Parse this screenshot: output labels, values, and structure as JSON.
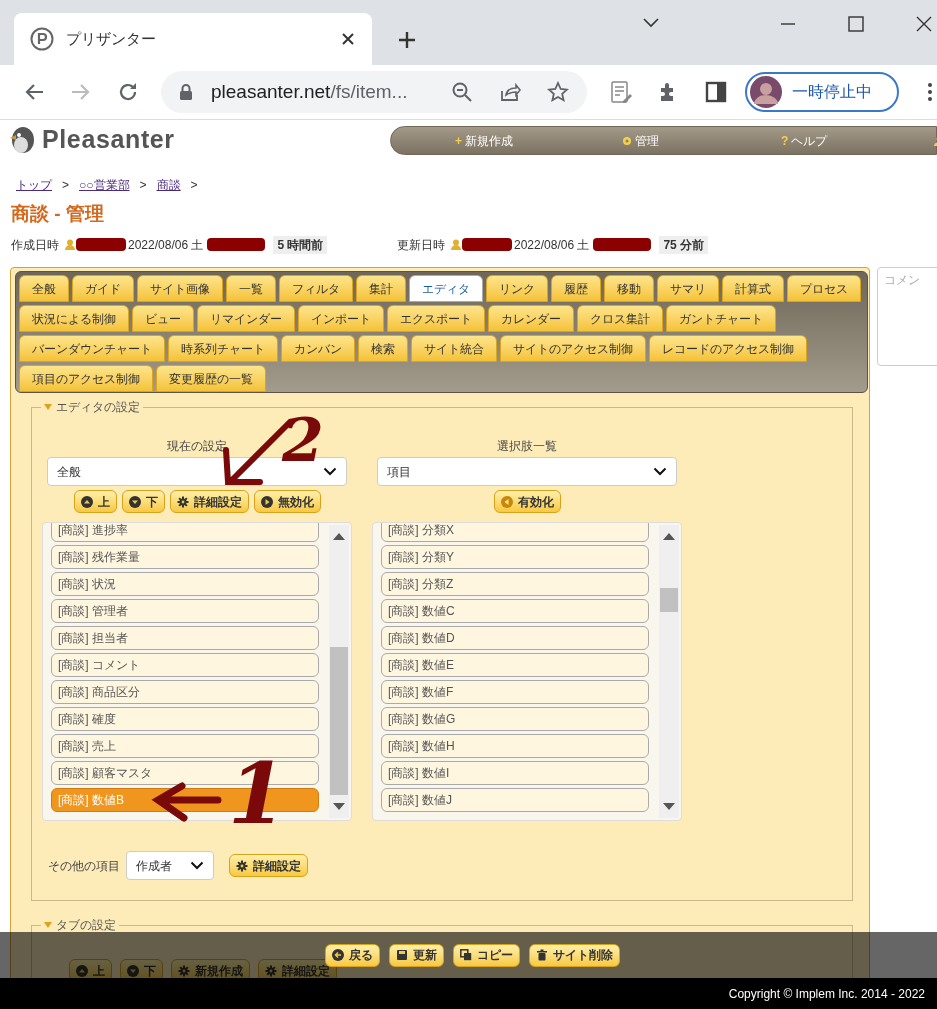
{
  "browser": {
    "tab_title": "プリザンター",
    "url_host": "pleasanter.net",
    "url_path": "/fs/item...",
    "profile_label": "一時停止中"
  },
  "header": {
    "logo_text": "Pleasanter",
    "nav": [
      {
        "kind": "char",
        "icon": "+",
        "label": "新規作成"
      },
      {
        "kind": "gear",
        "label": "管理"
      },
      {
        "kind": "char",
        "icon": "?",
        "label": "ヘルプ"
      },
      {
        "kind": "person"
      }
    ]
  },
  "breadcrumb": [
    {
      "label": "トップ",
      "separator": ">"
    },
    {
      "label": "○○営業部",
      "separator": ">"
    },
    {
      "label": "商談",
      "separator": ">"
    }
  ],
  "title": "商談 - 管理",
  "info": [
    {
      "label": "作成日時",
      "date": "2022/08/06 土",
      "relative": "5 時間前"
    },
    {
      "label": "更新日時",
      "date": "2022/08/06 土",
      "relative": "75 分前"
    }
  ],
  "tab_rows": [
    [
      {
        "label": "全般",
        "selected": false
      },
      {
        "label": "ガイド",
        "selected": false
      },
      {
        "label": "サイト画像",
        "selected": false
      },
      {
        "label": "一覧",
        "selected": false
      },
      {
        "label": "フィルタ",
        "selected": false
      },
      {
        "label": "集計",
        "selected": false
      },
      {
        "label": "エディタ",
        "selected": true
      },
      {
        "label": "リンク",
        "selected": false
      },
      {
        "label": "履歴",
        "selected": false
      },
      {
        "label": "移動",
        "selected": false
      },
      {
        "label": "サマリ",
        "selected": false
      },
      {
        "label": "計算式",
        "selected": false
      },
      {
        "label": "プロセス",
        "selected": false
      }
    ],
    [
      {
        "label": "状況による制御",
        "selected": false
      },
      {
        "label": "ビュー",
        "selected": false
      },
      {
        "label": "リマインダー",
        "selected": false
      },
      {
        "label": "インポート",
        "selected": false
      },
      {
        "label": "エクスポート",
        "selected": false
      },
      {
        "label": "カレンダー",
        "selected": false
      },
      {
        "label": "クロス集計",
        "selected": false
      },
      {
        "label": "ガントチャート",
        "selected": false
      }
    ],
    [
      {
        "label": "バーンダウンチャート",
        "selected": false
      },
      {
        "label": "時系列チャート",
        "selected": false
      },
      {
        "label": "カンバン",
        "selected": false
      },
      {
        "label": "検索",
        "selected": false
      },
      {
        "label": "サイト統合",
        "selected": false
      },
      {
        "label": "サイトのアクセス制御",
        "selected": false
      },
      {
        "label": "レコードのアクセス制御",
        "selected": false
      }
    ],
    [
      {
        "label": "項目のアクセス制御",
        "selected": false
      },
      {
        "label": "変更履歴の一覧",
        "selected": false
      }
    ]
  ],
  "comment": {
    "placeholder": "コメン"
  },
  "editor": {
    "legend": "エディタの設定",
    "current": {
      "heading": "現在の設定",
      "select": "全般",
      "buttons": [
        {
          "kind": "up",
          "label": "上"
        },
        {
          "kind": "down",
          "label": "下"
        },
        {
          "kind": "gear",
          "label": "詳細設定"
        },
        {
          "kind": "right",
          "label": "無効化"
        }
      ],
      "items": [
        {
          "label": "[商談] 進捗率",
          "selected": false
        },
        {
          "label": "[商談] 残作業量",
          "selected": false
        },
        {
          "label": "[商談] 状況",
          "selected": false
        },
        {
          "label": "[商談] 管理者",
          "selected": false
        },
        {
          "label": "[商談] 担当者",
          "selected": false
        },
        {
          "label": "[商談] コメント",
          "selected": false
        },
        {
          "label": "[商談] 商品区分",
          "selected": false
        },
        {
          "label": "[商談] 確度",
          "selected": false
        },
        {
          "label": "[商談] 売上",
          "selected": false
        },
        {
          "label": "[商談] 顧客マスタ",
          "selected": false
        },
        {
          "label": "[商談] 数値B",
          "selected": true
        }
      ]
    },
    "options": {
      "heading": "選択肢一覧",
      "select": "項目",
      "buttons": [
        {
          "kind": "left",
          "label": "有効化"
        }
      ],
      "items": [
        {
          "label": "[商談] 分類X",
          "selected": false
        },
        {
          "label": "[商談] 分類Y",
          "selected": false
        },
        {
          "label": "[商談] 分類Z",
          "selected": false
        },
        {
          "label": "[商談] 数値C",
          "selected": false
        },
        {
          "label": "[商談] 数値D",
          "selected": false
        },
        {
          "label": "[商談] 数値E",
          "selected": false
        },
        {
          "label": "[商談] 数値F",
          "selected": false
        },
        {
          "label": "[商談] 数値G",
          "selected": false
        },
        {
          "label": "[商談] 数値H",
          "selected": false
        },
        {
          "label": "[商談] 数値I",
          "selected": false
        },
        {
          "label": "[商談] 数値J",
          "selected": false
        }
      ]
    },
    "other": {
      "label": "その他の項目",
      "select": "作成者",
      "button": {
        "kind": "gear",
        "label": "詳細設定"
      }
    }
  },
  "tab_settings": {
    "legend": "タブの設定",
    "buttons": [
      {
        "kind": "up",
        "label": "上"
      },
      {
        "kind": "down",
        "label": "下"
      },
      {
        "kind": "gear",
        "label": "新規作成"
      },
      {
        "kind": "gear",
        "label": "詳細設定"
      }
    ]
  },
  "actions": [
    {
      "kind": "back",
      "label": "戻る"
    },
    {
      "kind": "save",
      "label": "更新"
    },
    {
      "kind": "copy",
      "label": "コピー"
    },
    {
      "kind": "trash",
      "label": "サイト削除"
    }
  ],
  "footer": "Copyright © Implem Inc. 2014 - 2022",
  "annotations": [
    {
      "number": "2"
    },
    {
      "number": "1"
    }
  ]
}
